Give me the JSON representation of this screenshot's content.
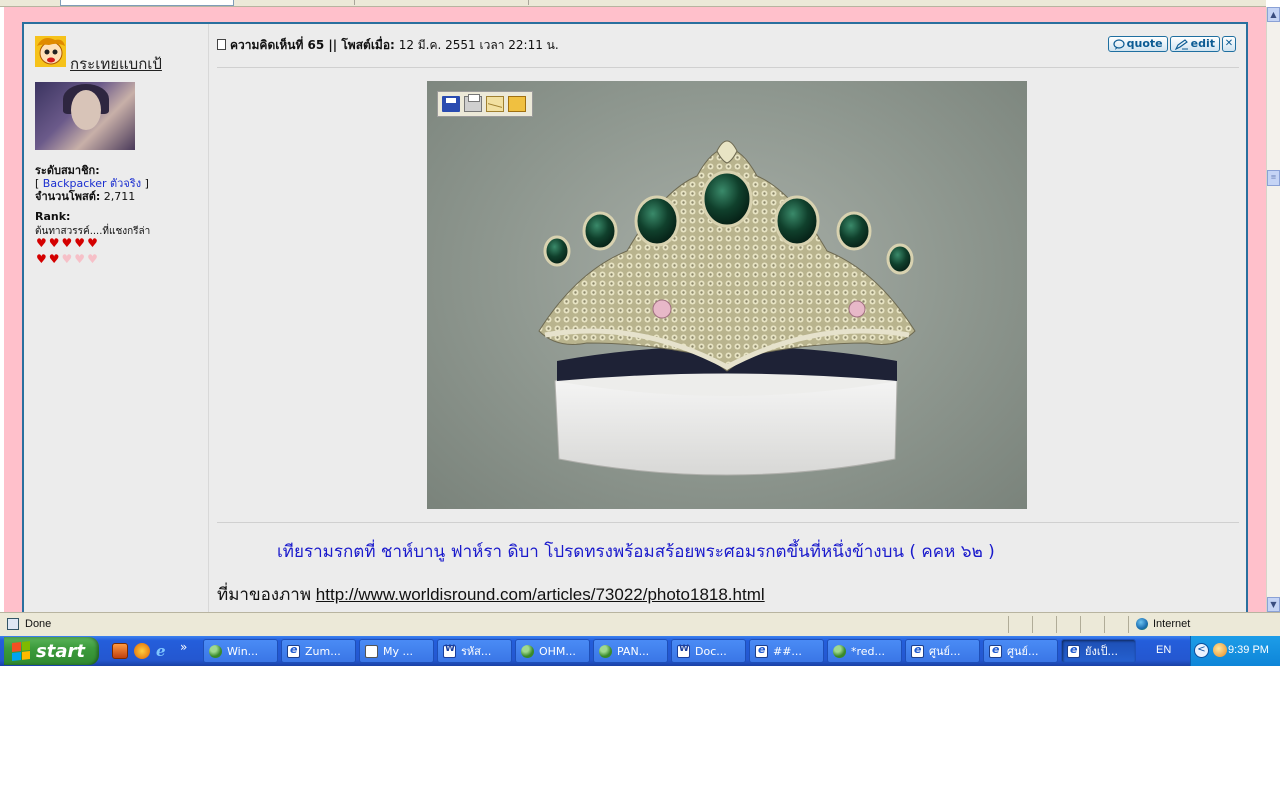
{
  "post": {
    "username": "กระเทยแบกเป้",
    "member_level_label": "ระดับสมาชิก:",
    "member_level_value": "Backpacker ตัวจริง",
    "post_count_label": "จำนวนโพสต์:",
    "post_count_value": "2,711",
    "rank_label": "Rank:",
    "rank_title": "ต้นทาสวรรค์....ที่แชงกรีล่า",
    "hearts_filled": 7,
    "hearts_total": 10,
    "comment_label": "ความคิดเห็นที่ 65 || โพสต์เมื่อ:",
    "comment_date": "12 มี.ค. 2551 เวลา 22:11 น.",
    "buttons": {
      "quote": "quote",
      "edit": "edit",
      "close_symbol": "✕"
    },
    "caption": "เทียรามรกตที่ ชาห์บานู ฟาห์รา ดิบา โปรดทรงพร้อมสร้อยพระศอมรกตขึ้นที่หนึ่งข้างบน ( คคห ๖๒ )",
    "source_label": "ที่มาของภาพ",
    "source_url": "http://www.worldisround.com/articles/73022/photo1818.html"
  },
  "photo_toolbar_icons": [
    "save-icon",
    "print-icon",
    "mail-icon",
    "folder-icon"
  ],
  "statusbar": {
    "text": "Done",
    "zone": "Internet"
  },
  "taskbar": {
    "start_label": "start",
    "tasks": [
      {
        "label": "Win...",
        "icon": "people-icon"
      },
      {
        "label": "Zum...",
        "icon": "ie-icon"
      },
      {
        "label": "My ...",
        "icon": "document-icon"
      },
      {
        "label": "รหัส...",
        "icon": "word-icon"
      },
      {
        "label": "OHM...",
        "icon": "people-icon"
      },
      {
        "label": "PAN...",
        "icon": "people-icon"
      },
      {
        "label": "Doc...",
        "icon": "word-icon"
      },
      {
        "label": "##...",
        "icon": "ie-icon"
      },
      {
        "label": "*red...",
        "icon": "people-icon"
      },
      {
        "label": "ศูนย์...",
        "icon": "ie-icon"
      },
      {
        "label": "ศูนย์...",
        "icon": "ie-icon"
      },
      {
        "label": "ยังเป็...",
        "icon": "ie-icon",
        "active": true
      }
    ],
    "language": "EN",
    "clock": "9:39 PM"
  },
  "colors": {
    "page_bg": "#ffc0cb",
    "post_border": "#2a6f9e",
    "caption_text": "#1a1acc",
    "taskbar_blue": "#245edb",
    "start_green": "#3c9b3c"
  }
}
